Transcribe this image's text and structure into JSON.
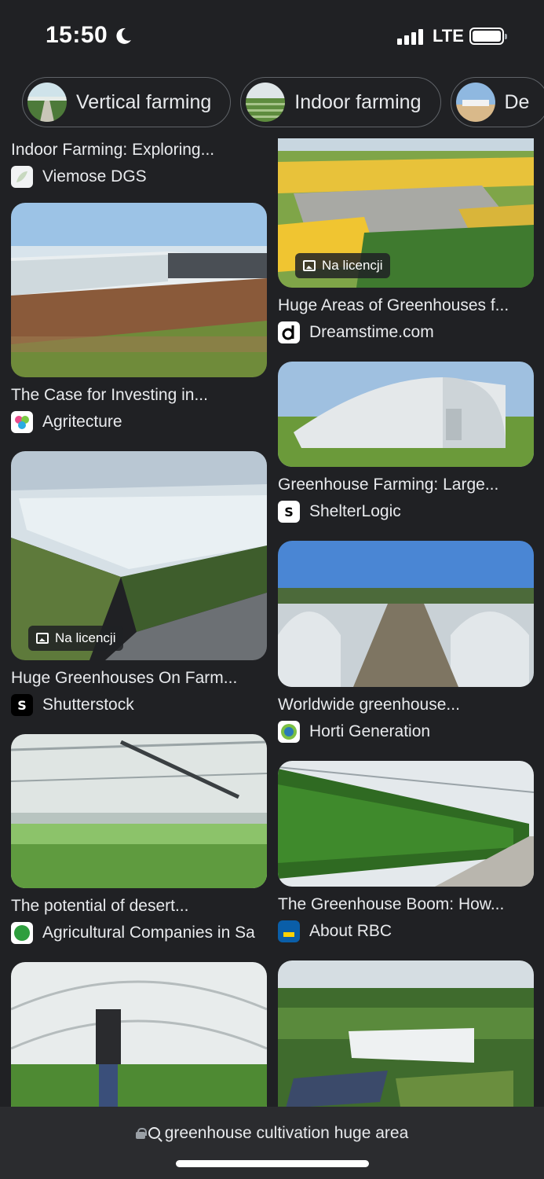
{
  "status": {
    "time": "15:50",
    "network": "LTE"
  },
  "chips": [
    {
      "label": "Vertical farming"
    },
    {
      "label": "Indoor farming"
    },
    {
      "label": "De"
    }
  ],
  "left_column": [
    {
      "title": "Indoor Farming: Exploring...",
      "source": "Viemose DGS",
      "has_image": false
    },
    {
      "title": "The Case for Investing in...",
      "source": "Agritecture"
    },
    {
      "title": "Huge Greenhouses On Farm...",
      "source": "Shutterstock",
      "badge": "Na licencji"
    },
    {
      "title": "The potential of desert...",
      "source": "Agricultural Companies in Sa"
    },
    {
      "title": "",
      "source": ""
    }
  ],
  "right_column": [
    {
      "title": "Huge Areas of Greenhouses f...",
      "source": "Dreamstime.com",
      "badge": "Na licencji"
    },
    {
      "title": "Greenhouse Farming: Large...",
      "source": "ShelterLogic"
    },
    {
      "title": "Worldwide greenhouse...",
      "source": "Horti Generation"
    },
    {
      "title": "The Greenhouse Boom: How...",
      "source": "About RBC"
    },
    {
      "title": "",
      "source": ""
    }
  ],
  "url_bar": {
    "query": "greenhouse cultivation huge area"
  },
  "colors": {
    "background": "#202124",
    "text": "#e8eaed",
    "url_bar": "#2b2c2f"
  }
}
